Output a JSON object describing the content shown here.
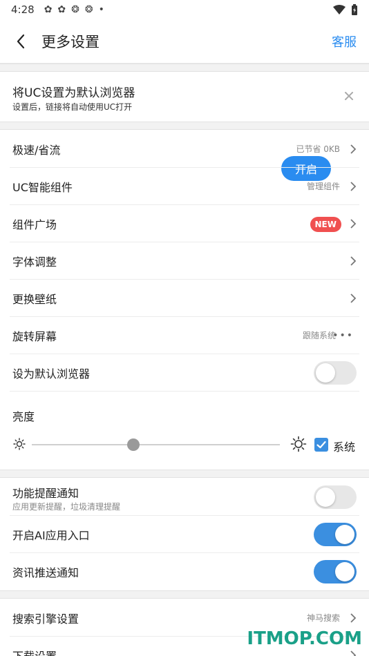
{
  "status_bar": {
    "time": "4:28",
    "dot": "•"
  },
  "header": {
    "title": "更多设置",
    "service_label": "客服"
  },
  "default_banner": {
    "title": "将UC设置为默认浏览器",
    "subtitle": "设置后，链接将自动使用UC打开",
    "open_label": "开启"
  },
  "settings_group_1": [
    {
      "label": "极速/省流",
      "value": "已节省 0KB"
    },
    {
      "label": "UC智能组件",
      "value": "管理组件"
    },
    {
      "label": "组件广场",
      "badge": "NEW"
    },
    {
      "label": "字体调整"
    },
    {
      "label": "更换壁纸"
    },
    {
      "label": "旋转屏幕",
      "value": "跟随系统",
      "more": "•••"
    },
    {
      "label": "设为默认浏览器",
      "toggle": false
    }
  ],
  "brightness": {
    "label": "亮度",
    "level_fraction": 0.41,
    "system_label": "系统",
    "system_checked": true
  },
  "notifications_group": [
    {
      "label": "功能提醒通知",
      "subtitle": "应用更新提醒，垃圾清理提醒",
      "toggle": false
    },
    {
      "label": "开启AI应用入口",
      "toggle": true
    },
    {
      "label": "资讯推送通知",
      "toggle": true
    }
  ],
  "settings_group_2": [
    {
      "label": "搜索引擎设置",
      "value": "神马搜索"
    },
    {
      "label": "下载设置"
    }
  ],
  "watermark": "ITMOP.COM",
  "colors": {
    "accent": "#2a8cf0",
    "toggle_on": "#3b8fe0",
    "badge": "#f05050",
    "watermark": "#1aa088"
  }
}
